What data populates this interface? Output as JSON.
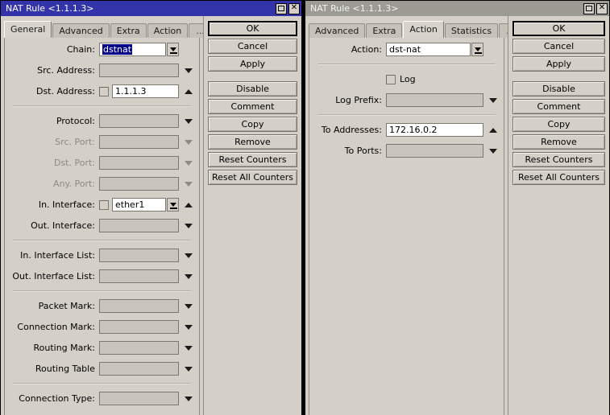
{
  "left_window": {
    "title": "NAT Rule <1.1.1.3>",
    "active": true,
    "controls": {
      "maximize": "maximize-restore",
      "close": "close"
    },
    "tabs": [
      {
        "label": "General",
        "active": true
      },
      {
        "label": "Advanced",
        "active": false
      },
      {
        "label": "Extra",
        "active": false
      },
      {
        "label": "Action",
        "active": false
      },
      {
        "label": "...",
        "active": false
      }
    ],
    "fields": [
      {
        "label": "Chain:",
        "value": "dstnat",
        "selected": true,
        "enabled": true,
        "checkbox": false,
        "control": "combo"
      },
      {
        "label": "Src. Address:",
        "value": "",
        "selected": false,
        "enabled": false,
        "checkbox": false,
        "control": "arrow-down"
      },
      {
        "label": "Dst. Address:",
        "value": "1.1.1.3",
        "selected": false,
        "enabled": true,
        "checkbox": true,
        "checked": false,
        "control": "arrow-up"
      },
      {
        "separator": true
      },
      {
        "label": "Protocol:",
        "value": "",
        "selected": false,
        "enabled": false,
        "checkbox": false,
        "control": "arrow-down",
        "label_dim": false
      },
      {
        "label": "Src. Port:",
        "value": "",
        "selected": false,
        "enabled": false,
        "checkbox": false,
        "control": "arrow-down",
        "label_dim": true
      },
      {
        "label": "Dst. Port:",
        "value": "",
        "selected": false,
        "enabled": false,
        "checkbox": false,
        "control": "arrow-down",
        "label_dim": true
      },
      {
        "label": "Any. Port:",
        "value": "",
        "selected": false,
        "enabled": false,
        "checkbox": false,
        "control": "arrow-down",
        "label_dim": true
      },
      {
        "label": "In. Interface:",
        "value": "ether1",
        "selected": false,
        "enabled": true,
        "checkbox": true,
        "checked": false,
        "control": "combo-arrow-up"
      },
      {
        "label": "Out. Interface:",
        "value": "",
        "selected": false,
        "enabled": false,
        "checkbox": false,
        "control": "arrow-down"
      },
      {
        "separator": true
      },
      {
        "label": "In. Interface List:",
        "value": "",
        "selected": false,
        "enabled": false,
        "checkbox": false,
        "control": "arrow-down"
      },
      {
        "label": "Out. Interface List:",
        "value": "",
        "selected": false,
        "enabled": false,
        "checkbox": false,
        "control": "arrow-down"
      },
      {
        "separator": true
      },
      {
        "label": "Packet Mark:",
        "value": "",
        "selected": false,
        "enabled": false,
        "checkbox": false,
        "control": "arrow-down"
      },
      {
        "label": "Connection Mark:",
        "value": "",
        "selected": false,
        "enabled": false,
        "checkbox": false,
        "control": "arrow-down"
      },
      {
        "label": "Routing Mark:",
        "value": "",
        "selected": false,
        "enabled": false,
        "checkbox": false,
        "control": "arrow-down"
      },
      {
        "label": "Routing Table",
        "value": "",
        "selected": false,
        "enabled": false,
        "checkbox": false,
        "control": "arrow-down"
      },
      {
        "separator": true
      },
      {
        "label": "Connection Type:",
        "value": "",
        "selected": false,
        "enabled": false,
        "checkbox": false,
        "control": "arrow-down"
      }
    ],
    "buttons": [
      {
        "label": "OK",
        "default": true
      },
      {
        "label": "Cancel"
      },
      {
        "label": "Apply"
      },
      {
        "gap": true
      },
      {
        "label": "Disable"
      },
      {
        "label": "Comment"
      },
      {
        "label": "Copy"
      },
      {
        "label": "Remove"
      },
      {
        "label": "Reset Counters"
      },
      {
        "label": "Reset All Counters"
      }
    ]
  },
  "right_window": {
    "title": "NAT Rule <1.1.1.3>",
    "active": false,
    "controls": {
      "maximize": "maximize-restore",
      "close": "close"
    },
    "tabs": [
      {
        "label": "Advanced",
        "active": false
      },
      {
        "label": "Extra",
        "active": false
      },
      {
        "label": "Action",
        "active": true
      },
      {
        "label": "Statistics",
        "active": false
      },
      {
        "label": "...",
        "active": false
      }
    ],
    "fields": [
      {
        "label": "Action:",
        "value": "dst-nat",
        "selected": false,
        "enabled": true,
        "checkbox": false,
        "control": "combo"
      },
      {
        "separator": true
      },
      {
        "checkbox_row": true,
        "label": "Log",
        "checked": false
      },
      {
        "label": "Log Prefix:",
        "value": "",
        "selected": false,
        "enabled": false,
        "checkbox": false,
        "control": "arrow-down"
      },
      {
        "separator": true
      },
      {
        "label": "To Addresses:",
        "value": "172.16.0.2",
        "selected": false,
        "enabled": true,
        "checkbox": false,
        "control": "arrow-up"
      },
      {
        "label": "To Ports:",
        "value": "",
        "selected": false,
        "enabled": false,
        "checkbox": false,
        "control": "arrow-down"
      }
    ],
    "buttons": [
      {
        "label": "OK",
        "default": true
      },
      {
        "label": "Cancel"
      },
      {
        "label": "Apply"
      },
      {
        "gap": true
      },
      {
        "label": "Disable"
      },
      {
        "label": "Comment"
      },
      {
        "label": "Copy"
      },
      {
        "label": "Remove"
      },
      {
        "label": "Reset Counters"
      },
      {
        "label": "Reset All Counters"
      }
    ]
  },
  "colors": {
    "window_face": "#d4d0c8",
    "titlebar_active": "#3333aa",
    "titlebar_inactive": "#9b9a93",
    "selection": "#00008b",
    "field_disabled": "#c9c5bd",
    "desktop": "#000000"
  }
}
